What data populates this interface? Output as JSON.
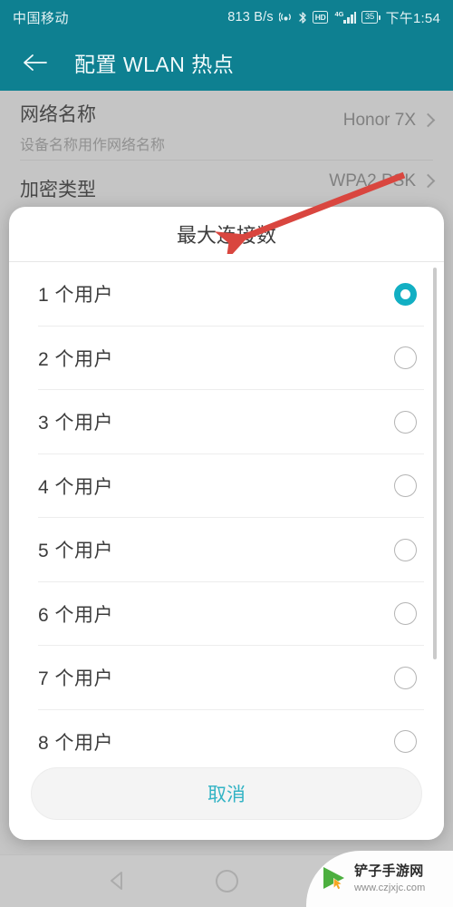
{
  "status_bar": {
    "carrier": "中国移动",
    "net_speed": "813 B/s",
    "hd_label": "HD",
    "network_gen": "4G",
    "battery_level": "35",
    "clock": "下午1:54"
  },
  "app_bar": {
    "back_icon": "back-arrow-icon",
    "title": "配置 WLAN 热点"
  },
  "settings_page": {
    "rows": [
      {
        "title": "网络名称",
        "subtitle": "设备名称用作网络名称",
        "value": "Honor 7X"
      },
      {
        "title": "加密类型",
        "subtitle": "",
        "value": "WPA2 PSK"
      }
    ]
  },
  "dialog": {
    "title": "最大连接数",
    "options": [
      {
        "label": "1 个用户",
        "selected": true
      },
      {
        "label": "2 个用户",
        "selected": false
      },
      {
        "label": "3 个用户",
        "selected": false
      },
      {
        "label": "4 个用户",
        "selected": false
      },
      {
        "label": "5 个用户",
        "selected": false
      },
      {
        "label": "6 个用户",
        "selected": false
      },
      {
        "label": "7 个用户",
        "selected": false
      },
      {
        "label": "8 个用户",
        "selected": false
      }
    ],
    "cancel_label": "取消",
    "accent_color": "#12afc3",
    "cancel_text_color": "#32b3c4"
  },
  "annotation": {
    "type": "arrow",
    "color": "#d9463f"
  },
  "nav_bar": {
    "back_label": "back-nav-button",
    "home_label": "home-nav-button",
    "recents_label": "recents-nav-button"
  },
  "watermark": {
    "site_name": "铲子手游网",
    "site_url": "www.czjxjc.com"
  },
  "theme": {
    "primary": "#0e8091",
    "page_bg": "#c9c9c9"
  }
}
